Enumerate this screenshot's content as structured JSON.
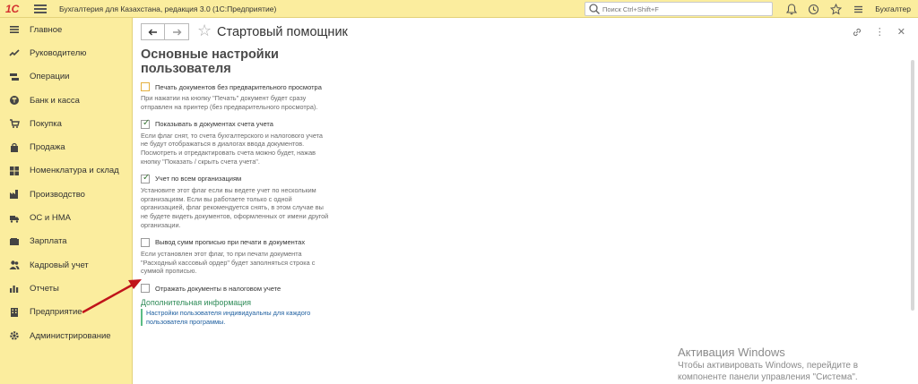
{
  "topbar": {
    "logo": "1С",
    "app_title": "Бухгалтерия для Казахстана, редакция 3.0  (1С:Предприятие)",
    "search_placeholder": "Поиск Ctrl+Shift+F",
    "user": "Бухгалтер"
  },
  "sidebar": {
    "items": [
      {
        "label": "Главное",
        "icon": "menu-icon"
      },
      {
        "label": "Руководителю",
        "icon": "trend-icon"
      },
      {
        "label": "Операции",
        "icon": "operations-icon"
      },
      {
        "label": "Банк и касса",
        "icon": "bank-icon"
      },
      {
        "label": "Покупка",
        "icon": "cart-icon"
      },
      {
        "label": "Продажа",
        "icon": "bag-icon"
      },
      {
        "label": "Номенклатура и склад",
        "icon": "grid-icon"
      },
      {
        "label": "Производство",
        "icon": "factory-icon"
      },
      {
        "label": "ОС и НМА",
        "icon": "truck-icon"
      },
      {
        "label": "Зарплата",
        "icon": "wallet-icon"
      },
      {
        "label": "Кадровый учет",
        "icon": "people-icon"
      },
      {
        "label": "Отчеты",
        "icon": "bar-chart-icon"
      },
      {
        "label": "Предприятие",
        "icon": "building-icon"
      },
      {
        "label": "Администрирование",
        "icon": "gear-icon"
      }
    ]
  },
  "form": {
    "title": "Стартовый помощник",
    "heading_line1": "Основные настройки",
    "heading_line2": "пользователя",
    "options": [
      {
        "label": "Печать документов без предварительного просмотра",
        "checked": false,
        "desc": "При нажатии на кнопку \"Печать\" документ будет сразу\nотправлен на принтер (без предварительного просмотра)."
      },
      {
        "label": "Показывать в документах счета учета",
        "checked": true,
        "desc": "Если флаг снят, то счета бухгалтерского и налогового учета\nне будут отображаться в диалогах ввода документов.\nПосмотреть и отредактировать счета можно будет, нажав\nкнопку \"Показать / скрыть счета учета\"."
      },
      {
        "label": "Учет по всем организациям",
        "checked": true,
        "desc": "Установите этот флаг если вы ведете учет по нескольким\nорганизациям. Если вы работаете только с одной\nорганизацией, флаг рекомендуется снять, в этом случае вы\nне будете видеть документов, оформленных от имени другой\nорганизации."
      },
      {
        "label": "Вывод сумм прописью при печати в документах",
        "checked": false,
        "desc": "Если установлен этот флаг, то при печати  документа\n\"Расходный кассовый ордер\" будет заполняться строка с\nсуммой прописью."
      },
      {
        "label": "Отражать документы в налоговом учете",
        "checked": false,
        "desc": ""
      }
    ],
    "more_info_title": "Дополнительная информация",
    "more_info_text": "Настройки пользователя индивидуальны для каждого\nпользователя программы."
  },
  "watermark": {
    "line1": "Активация Windows",
    "line2": "Чтобы активировать Windows, перейдите в",
    "line3": "компоненте панели управления \"Система\"."
  },
  "colors": {
    "panel": "#fbed9e",
    "link_green": "#2e8b57",
    "arrow_red": "#c0141a"
  }
}
